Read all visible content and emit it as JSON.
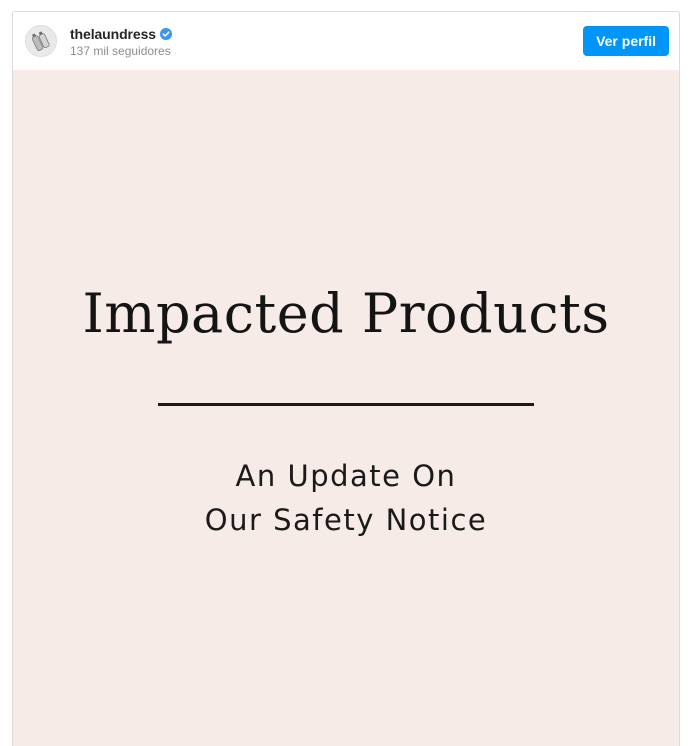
{
  "header": {
    "username": "thelaundress",
    "verified_icon": "verified-badge-icon",
    "followers": "137 mil seguidores",
    "profile_button_label": "Ver perfil"
  },
  "media": {
    "title": "Impacted Products",
    "subtitle_line1": "An Update On",
    "subtitle_line2": "Our Safety Notice",
    "background_color": "#f6ebe6"
  },
  "colors": {
    "accent": "#0095f6",
    "verified": "#3897f0"
  }
}
